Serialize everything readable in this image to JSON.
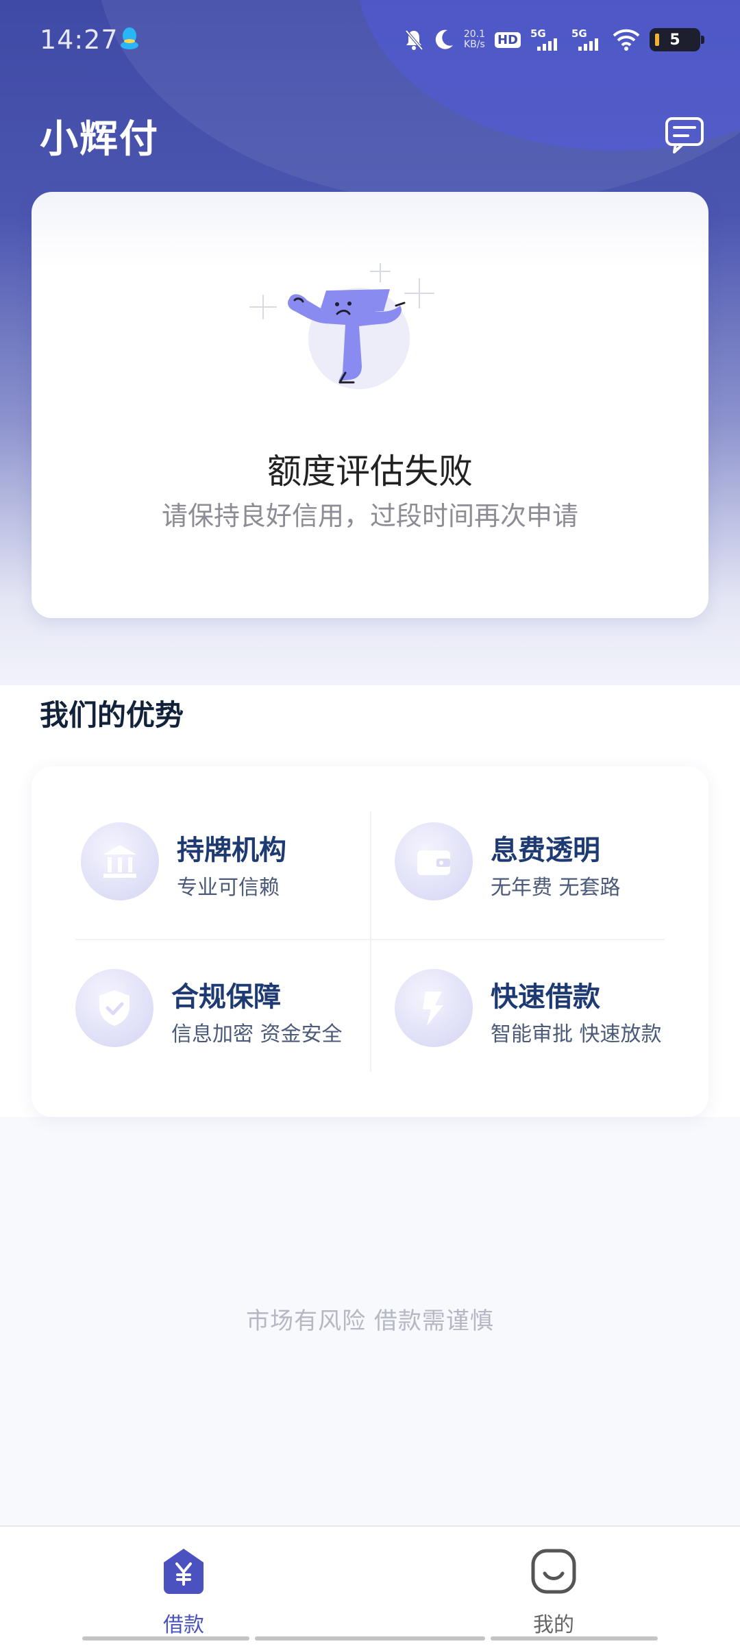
{
  "status_bar": {
    "time": "14:27",
    "network_speed": "20.1",
    "network_speed_unit": "KB/s",
    "hd_label": "HD",
    "sim1_label": "5G",
    "sim2_label": "5G",
    "battery_level": "5",
    "icons": [
      "qq-icon",
      "mute-icon",
      "moon-icon",
      "hd-icon",
      "signal-icon",
      "signal-icon",
      "wifi-icon",
      "battery-icon"
    ]
  },
  "header": {
    "title": "小辉付",
    "message_icon": "message-icon"
  },
  "status_card": {
    "title": "额度评估失败",
    "subtitle": "请保持良好信用，过段时间再次申请"
  },
  "advantages": {
    "section_title": "我们的优势",
    "items": [
      {
        "title": "持牌机构",
        "desc": "专业可信赖",
        "icon": "bank-icon"
      },
      {
        "title": "息费透明",
        "desc": "无年费 无套路",
        "icon": "wallet-icon"
      },
      {
        "title": "合规保障",
        "desc": "信息加密 资金安全",
        "icon": "shield-icon"
      },
      {
        "title": "快速借款",
        "desc": "智能审批 快速放款",
        "icon": "lightning-icon"
      }
    ]
  },
  "risk_notice": "市场有风险 借款需谨慎",
  "bottom_nav": {
    "items": [
      {
        "label": "借款",
        "icon": "yuan-icon",
        "active": true
      },
      {
        "label": "我的",
        "icon": "smile-icon",
        "active": false
      }
    ]
  },
  "colors": {
    "brand": "#4b52c0",
    "header_bg": "#3f4aa6",
    "advantage_title": "#1e3a73"
  }
}
